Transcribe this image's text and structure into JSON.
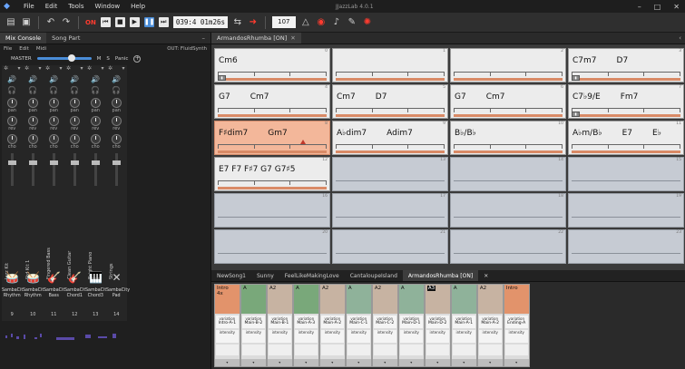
{
  "app": {
    "title": "JJazzLab 4.0.1",
    "logo_icon": "jjazz-logo-icon"
  },
  "menu": [
    "File",
    "Edit",
    "Tools",
    "Window",
    "Help"
  ],
  "toolbar": {
    "on_label": "ON",
    "position": "039:4 01m26s",
    "tempo": "107"
  },
  "mixer": {
    "tab_active": "Mix Console",
    "tab_other": "Song Part",
    "menu": [
      "File",
      "Edit",
      "Midi"
    ],
    "synth": "OUT: FluidSynth",
    "master_label": "MASTER",
    "m_label": "M",
    "s_label": "S",
    "panic_label": "Panic",
    "knob_labels": [
      "pan",
      "rev",
      "cho"
    ],
    "channels": [
      {
        "vname": "Jazz Kit",
        "icon": "drums-icon",
        "glyph": "🥁",
        "name": "SambaCity Rhythm",
        "num": "9"
      },
      {
        "vname": "Std Kit 1",
        "icon": "drums-icon",
        "glyph": "🥁",
        "name": "SambaCity Rhythm",
        "num": "10"
      },
      {
        "vname": "Fingered Bass",
        "icon": "bass-icon",
        "glyph": "🎸",
        "name": "SambaCity Bass",
        "num": "11"
      },
      {
        "vname": "Clean Guitar",
        "icon": "guitar-icon",
        "glyph": "🎸",
        "name": "SambaCity Chord1",
        "num": "12"
      },
      {
        "vname": "Bright Piano",
        "icon": "keyboard-icon",
        "glyph": "🎹",
        "name": "SambaCity Chord3",
        "num": "13"
      },
      {
        "vname": "Strings",
        "icon": "pad-icon",
        "glyph": "✕",
        "name": "SambaCity Pad",
        "num": "14"
      }
    ]
  },
  "editor": {
    "tab": "ArmandosRhumba [ON]",
    "bars": [
      {
        "chords": [
          "Cm6"
        ],
        "num": "0",
        "state": "normal",
        "marker": true
      },
      {
        "chords": [],
        "num": "1",
        "state": "normal"
      },
      {
        "chords": [],
        "num": "2",
        "state": "normal"
      },
      {
        "chords": [
          "C7m7",
          "D7"
        ],
        "num": "3",
        "state": "normal",
        "marker": true
      },
      {
        "chords": [
          "G7",
          "Cm7"
        ],
        "num": "4",
        "state": "normal"
      },
      {
        "chords": [
          "Cm7",
          "D7"
        ],
        "num": "5",
        "state": "normal"
      },
      {
        "chords": [
          "G7",
          "Cm7"
        ],
        "num": "6",
        "state": "normal"
      },
      {
        "chords": [
          "C7♭9/E",
          "Fm7"
        ],
        "num": "7",
        "state": "normal",
        "marker": true
      },
      {
        "chords": [
          "F♯dim7",
          "Gm7"
        ],
        "num": "8",
        "state": "selected"
      },
      {
        "chords": [
          "A♭dim7",
          "Adim7"
        ],
        "num": "9",
        "state": "normal"
      },
      {
        "chords": [
          "B♭/B♭"
        ],
        "num": "10",
        "state": "normal"
      },
      {
        "chords": [
          "A♭m/B♭",
          "E7",
          "E♭"
        ],
        "num": "11",
        "state": "normal"
      },
      {
        "chords": [
          "E7 F7 F♯7 G7 G7♯5"
        ],
        "num": "12",
        "state": "normal"
      },
      {
        "chords": [],
        "num": "13",
        "state": "empty"
      },
      {
        "chords": [],
        "num": "14",
        "state": "empty"
      },
      {
        "chords": [],
        "num": "15",
        "state": "empty"
      },
      {
        "chords": [],
        "num": "16",
        "state": "empty"
      },
      {
        "chords": [],
        "num": "17",
        "state": "empty"
      },
      {
        "chords": [],
        "num": "18",
        "state": "empty"
      },
      {
        "chords": [],
        "num": "19",
        "state": "empty"
      },
      {
        "chords": [],
        "num": "20",
        "state": "empty"
      },
      {
        "chords": [],
        "num": "21",
        "state": "empty"
      },
      {
        "chords": [],
        "num": "22",
        "state": "empty"
      },
      {
        "chords": [],
        "num": "23",
        "state": "empty"
      }
    ]
  },
  "songs": {
    "tabs": [
      "NewSong1",
      "Sunny",
      "FeelLikeMakingLove",
      "CantaloupeIsland",
      "ArmandosRhumba [ON]"
    ],
    "active": 4,
    "parts": [
      {
        "name": "Intro",
        "cls": "intro",
        "sub": "4x",
        "var": "Intro-A-1",
        "badge": false
      },
      {
        "name": "A",
        "cls": "mainA",
        "sub": "",
        "var": "Main-B-2",
        "badge": false
      },
      {
        "name": "A2",
        "cls": "mainB",
        "sub": "",
        "var": "Main-B-1",
        "badge": false
      },
      {
        "name": "A",
        "cls": "mainA",
        "sub": "",
        "var": "Main-A-3",
        "badge": false
      },
      {
        "name": "A2",
        "cls": "mainB",
        "sub": "",
        "var": "Main-A-2",
        "badge": false
      },
      {
        "name": "A",
        "cls": "mainC",
        "sub": "",
        "var": "Main-C-1",
        "badge": false
      },
      {
        "name": "A2",
        "cls": "mainB",
        "sub": "",
        "var": "Main-C-2",
        "badge": false
      },
      {
        "name": "A",
        "cls": "mainC",
        "sub": "",
        "var": "Main-D-1",
        "badge": false
      },
      {
        "name": "A3",
        "cls": "mainB",
        "sub": "",
        "var": "Main-D-2",
        "badge": true
      },
      {
        "name": "A",
        "cls": "mainC",
        "sub": "",
        "var": "Main-A-1",
        "badge": false
      },
      {
        "name": "A2",
        "cls": "mainB",
        "sub": "",
        "var": "Main-A-2",
        "badge": false
      },
      {
        "name": "Intro",
        "cls": "intro",
        "sub": "",
        "var": "Ending-A",
        "badge": false
      }
    ],
    "var_label": "variation",
    "int_label": "intensity"
  }
}
